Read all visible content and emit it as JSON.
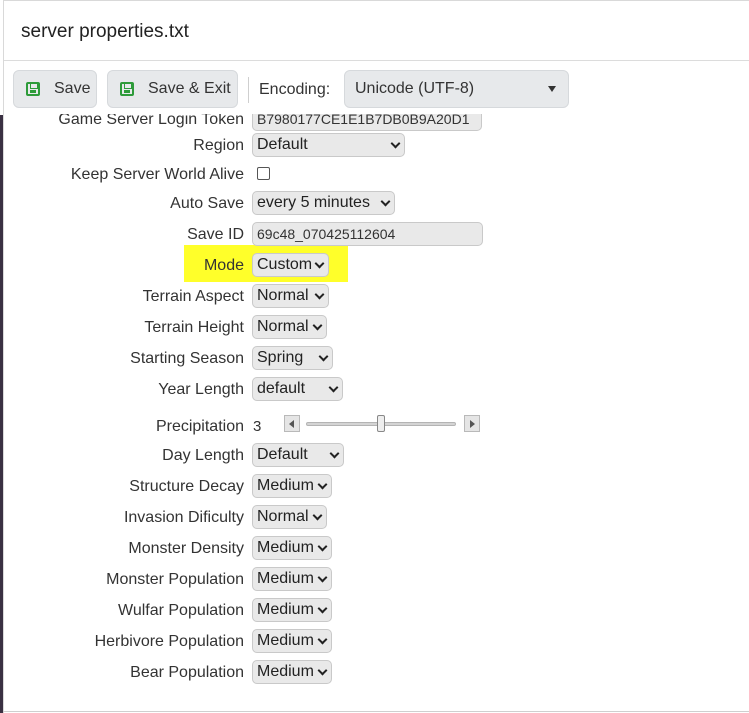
{
  "window": {
    "title": "server properties.txt"
  },
  "toolbar": {
    "save_label": "Save",
    "save_exit_label": "Save & Exit",
    "encoding_label": "Encoding:",
    "encoding_value": "Unicode (UTF-8)"
  },
  "form": {
    "partial_top": {
      "label": "Game Server Login Token",
      "value": "B7980177CE1E1B7DB0B9A20D1"
    },
    "region": {
      "label": "Region",
      "value": "Default"
    },
    "keep_alive": {
      "label": "Keep Server World Alive",
      "checked": false
    },
    "auto_save": {
      "label": "Auto Save",
      "value": "every 5 minutes"
    },
    "save_id": {
      "label": "Save ID",
      "value": "69c48_070425112604"
    },
    "mode": {
      "label": "Mode",
      "value": "Custom"
    },
    "terrain_aspect": {
      "label": "Terrain Aspect",
      "value": "Normal"
    },
    "terrain_height": {
      "label": "Terrain Height",
      "value": "Normal"
    },
    "starting_season": {
      "label": "Starting Season",
      "value": "Spring"
    },
    "year_length": {
      "label": "Year Length",
      "value": "default"
    },
    "precipitation": {
      "label": "Precipitation",
      "value": "3"
    },
    "day_length": {
      "label": "Day Length",
      "value": "Default"
    },
    "structure_decay": {
      "label": "Structure Decay",
      "value": "Medium"
    },
    "invasion_difficulty": {
      "label": "Invasion Dificulty",
      "value": "Normal"
    },
    "monster_density": {
      "label": "Monster Density",
      "value": "Medium"
    },
    "monster_population": {
      "label": "Monster Population",
      "value": "Medium"
    },
    "wulfar_population": {
      "label": "Wulfar Population",
      "value": "Medium"
    },
    "herbivore_population": {
      "label": "Herbivore Population",
      "value": "Medium"
    },
    "bear_population": {
      "label": "Bear Population",
      "value": "Medium"
    }
  },
  "colors": {
    "highlight": "#ffff2a",
    "save_icon": "#2e9b3a"
  }
}
